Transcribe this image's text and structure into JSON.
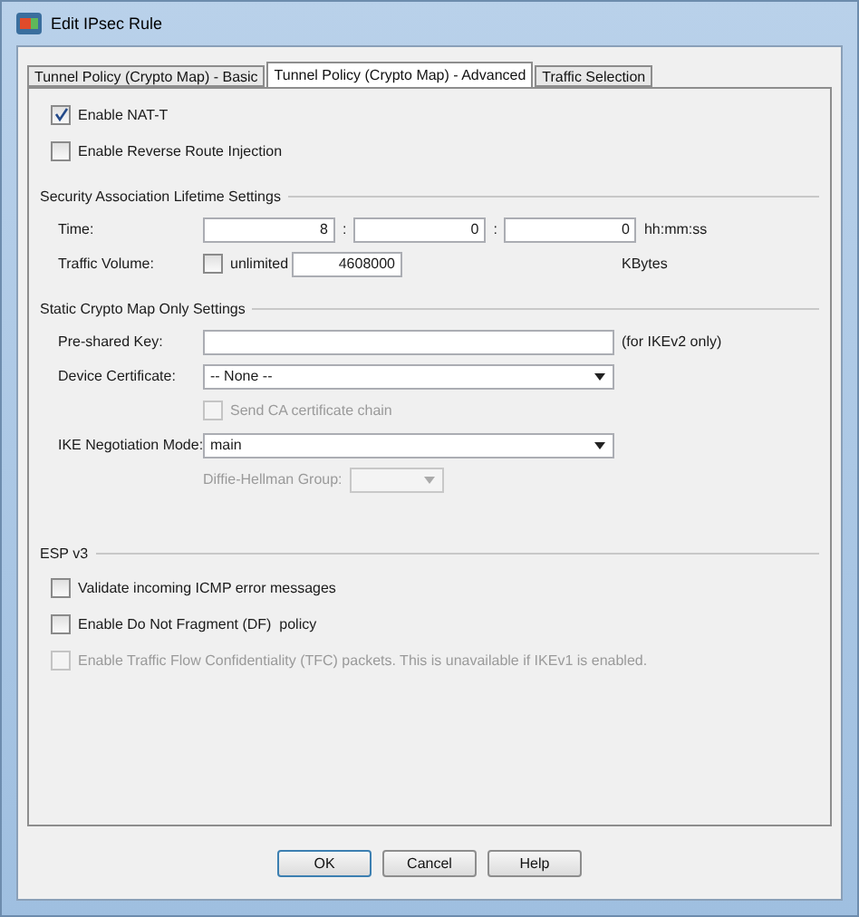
{
  "window": {
    "title": "Edit IPsec Rule"
  },
  "tabs": [
    {
      "label": "Tunnel Policy (Crypto Map) - Basic",
      "selected": false
    },
    {
      "label": "Tunnel Policy (Crypto Map) - Advanced",
      "selected": true
    },
    {
      "label": "Traffic Selection",
      "selected": false
    }
  ],
  "options": [
    {
      "label": "Enable NAT-T",
      "checked": true
    },
    {
      "label": "Enable Reverse Route Injection",
      "checked": false
    }
  ],
  "sa_lifetime": {
    "title": "Security Association Lifetime Settings",
    "time": {
      "label": "Time:",
      "values": [
        "8",
        "0",
        "0"
      ],
      "separators": [
        ":",
        ":"
      ],
      "unit": "hh:mm:ss"
    },
    "traffic_volume": {
      "label": "Traffic Volume:",
      "unlimited": {
        "label": "unlimited",
        "checked": false
      },
      "value": "4608000",
      "unit": "KBytes"
    }
  },
  "static_crypto": {
    "title": "Static Crypto Map Only Settings",
    "pre_shared_key": {
      "label": "Pre-shared Key:",
      "note": "(for IKEv2 only)"
    },
    "device_certificate": {
      "label": "Device Certificate:",
      "value": "-- None --"
    },
    "send_ca": {
      "label": "Send CA certificate chain",
      "checked": false,
      "disabled": true
    },
    "ike_mode": {
      "label": "IKE Negotiation Mode:",
      "value": "main"
    },
    "dh_group": {
      "label": "Diffie-Hellman Group:",
      "disabled": true
    }
  },
  "esp_v3": {
    "title": "ESP v3",
    "options": [
      {
        "label": "Validate incoming ICMP error messages",
        "checked": false,
        "disabled": false
      },
      {
        "label": "Enable Do Not Fragment (DF)  policy",
        "checked": false,
        "disabled": false
      },
      {
        "label": "Enable Traffic Flow Confidentiality (TFC) packets. This is unavailable if IKEv1 is enabled.",
        "checked": false,
        "disabled": true
      }
    ]
  },
  "buttons": [
    {
      "label": "OK",
      "default": true
    },
    {
      "label": "Cancel",
      "default": false
    },
    {
      "label": "Help",
      "default": false
    }
  ]
}
